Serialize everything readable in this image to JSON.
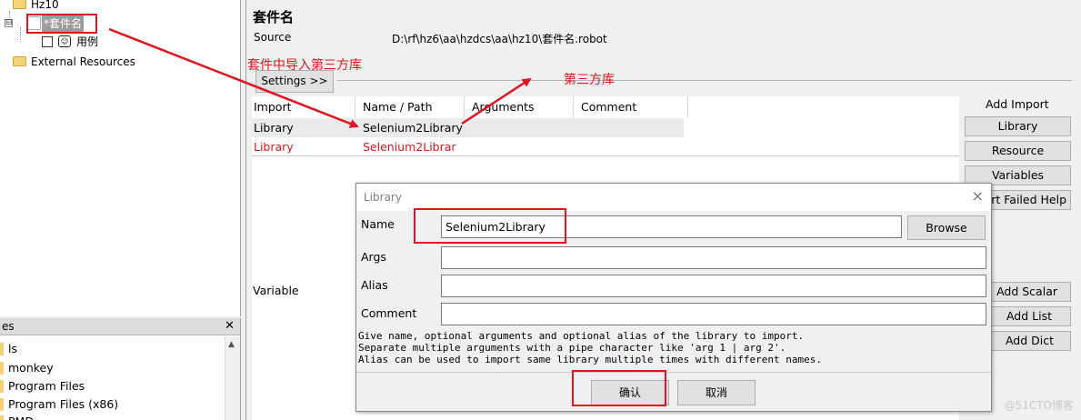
{
  "tree": {
    "root_label": "Hz10",
    "suite_label": "*套件名",
    "testcase_label": "用例",
    "external_label": "External Resources",
    "expander_symbol": "⊟"
  },
  "files_panel": {
    "title": "es",
    "items": [
      "ls",
      "monkey",
      "Program Files",
      "Program Files (x86)",
      "PMD..."
    ]
  },
  "editor": {
    "suite_title": "套件名",
    "source_label": "Source",
    "source_value": "D:\\rf\\hz6\\aa\\hzdcs\\aa\\hz10\\套件名.robot",
    "settings_button": "Settings >>",
    "columns": [
      "Import",
      "Name / Path",
      "Arguments",
      "Comment"
    ],
    "rows": [
      {
        "import": "Library",
        "name": "Selenium2Library"
      },
      {
        "import": "Library",
        "name": "Selenium2Librar"
      }
    ],
    "variable_label": "Variable",
    "add_import_label": "Add Import",
    "import_buttons": [
      "Library",
      "Resource",
      "Variables",
      "ort Failed Help"
    ],
    "variable_buttons": [
      "Add Scalar",
      "Add List",
      "Add Dict"
    ]
  },
  "annotations": {
    "import_note": "套件中导入第三方库",
    "third_party_note": "第三方库"
  },
  "dialog": {
    "title": "Library",
    "name_label": "Name",
    "name_value": "Selenium2Library",
    "browse_button": "Browse",
    "args_label": "Args",
    "alias_label": "Alias",
    "comment_label": "Comment",
    "help_line1": "Give name, optional arguments and optional alias of the library to import.",
    "help_line2": "Separate multiple arguments with a pipe character like 'arg 1 | arg 2'.",
    "help_line3": "Alias can be used to import same library multiple times with different names.",
    "ok_button": "确认",
    "cancel_button": "取消",
    "close_symbol": "×"
  },
  "watermark": "@51CTO博客",
  "colors": {
    "annotation": "#e0141e",
    "folder": "#f5d27a"
  }
}
